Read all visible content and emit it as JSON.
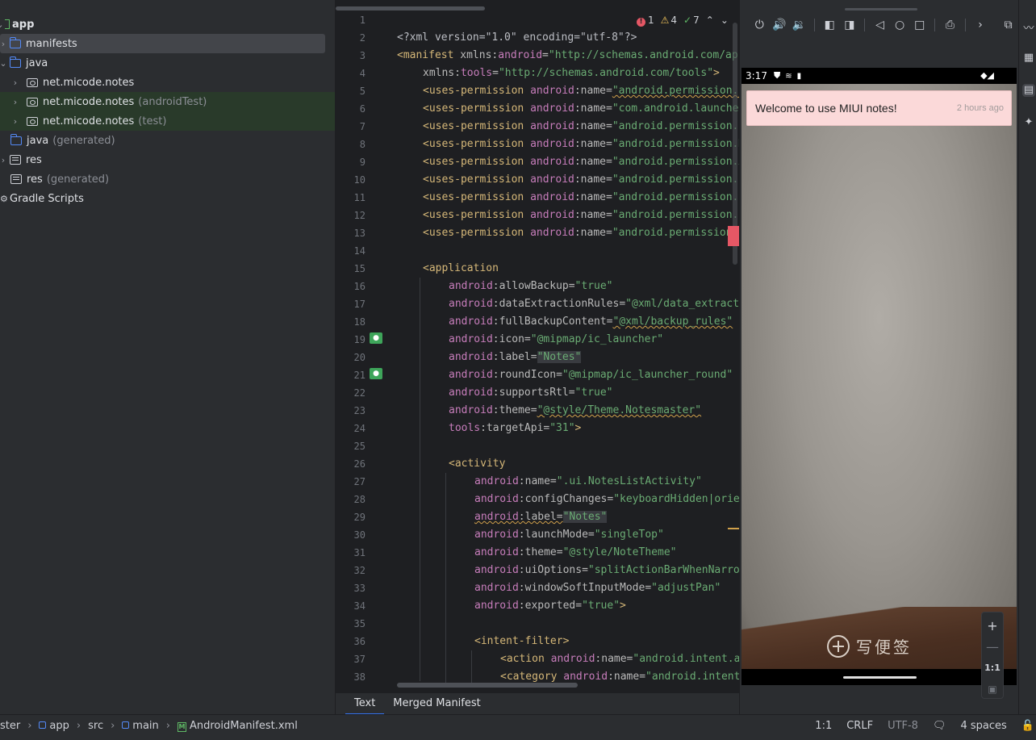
{
  "project_tree": {
    "items": [
      {
        "label": "app",
        "suffix": "",
        "icon": "module-icon"
      },
      {
        "label": "manifests",
        "suffix": "",
        "icon": "folder-icon"
      },
      {
        "label": "java",
        "suffix": "",
        "icon": "folder-icon"
      },
      {
        "label": "net.micode.notes",
        "suffix": "",
        "icon": "package-icon"
      },
      {
        "label": "net.micode.notes",
        "suffix": "(androidTest)",
        "icon": "package-icon"
      },
      {
        "label": "net.micode.notes",
        "suffix": "(test)",
        "icon": "package-icon"
      },
      {
        "label": "java",
        "suffix": "(generated)",
        "icon": "folder-icon"
      },
      {
        "label": "res",
        "suffix": "",
        "icon": "res-folder-icon"
      },
      {
        "label": "res",
        "suffix": "(generated)",
        "icon": "res-folder-icon"
      },
      {
        "label": "Gradle Scripts",
        "suffix": "",
        "icon": "gradle-icon"
      }
    ]
  },
  "editor": {
    "inspections": {
      "errors": "1",
      "warnings": "4",
      "typos": "7"
    },
    "line_numbers": [
      "1",
      "2",
      "3",
      "4",
      "5",
      "6",
      "7",
      "8",
      "9",
      "10",
      "11",
      "12",
      "13",
      "14",
      "15",
      "16",
      "17",
      "18",
      "19",
      "20",
      "21",
      "22",
      "23",
      "24",
      "25",
      "26",
      "27",
      "28",
      "29",
      "30",
      "31",
      "32",
      "33",
      "34",
      "35",
      "36",
      "37",
      "38"
    ],
    "lines": {
      "l1": "<?xml version=\"1.0\" encoding=\"utf-8\"?>",
      "l2a": "<manifest",
      "l2b": " xmlns:",
      "l2c": "android",
      "l2d": "=",
      "l2e": "\"http://schemas.android.com/apk/res/android\"",
      "l3a": "xmlns:",
      "l3b": "tools",
      "l3c": "=",
      "l3d": "\"http://schemas.android.com/tools\"",
      "l3e": ">",
      "perm_tag": "<uses-permission",
      "ns_android": "android",
      "attr_name": ":name=",
      "l5": "\"android.permission.INTERNET\"",
      "l6": "\"com.android.launcher.permission.INSTALL_SHORTCUT\"",
      "l7": "\"android.permission.READ_CONTACTS\"",
      "l8": "\"android.permission.MANAGE_ACCOUNTS\"",
      "l9": "\"android.permission.AUTHENTICATE_ACCOUNTS\"",
      "l10": "\"android.permission.GET_ACCOUNTS\"",
      "l11": "\"android.permission.USE_CREDENTIALS\"",
      "l12": "\"android.permission.RECEIVE_BOOT_COMPLETED\"",
      "l13": "\"android.permission.WRITE_EXTERNAL_STORAGE\"",
      "l15": "<application",
      "l16a": ":allowBackup=",
      "l16b": "\"true\"",
      "l17a": ":dataExtractionRules=",
      "l17b": "\"@xml/data_extraction_rules\"",
      "l18a": ":fullBackupContent=",
      "l18b": "\"@xml/backup_rules\"",
      "l19a": ":icon=",
      "l19b": "\"@mipmap/ic_launcher\"",
      "l20a": ":label=",
      "l20b": "\"Notes\"",
      "l21a": ":roundIcon=",
      "l21b": "\"@mipmap/ic_launcher_round\"",
      "l22a": ":supportsRtl=",
      "l22b": "\"true\"",
      "l23a": ":theme=",
      "l23b": "\"@style/Theme.Notesmaster\"",
      "l24ns": "tools",
      "l24a": ":targetApi=",
      "l24b": "\"31\"",
      "l24c": ">",
      "l26": "<activity",
      "l27a": ":name=",
      "l27b": "\".ui.NotesListActivity\"",
      "l28a": ":configChanges=",
      "l28b": "\"keyboardHidden|orientation\"",
      "l29a": ":label=",
      "l29b": "\"Notes\"",
      "l30a": ":launchMode=",
      "l30b": "\"singleTop\"",
      "l31a": ":theme=",
      "l31b": "\"@style/NoteTheme\"",
      "l32a": ":uiOptions=",
      "l32b": "\"splitActionBarWhenNarrow\"",
      "l33a": ":windowSoftInputMode=",
      "l33b": "\"adjustPan\"",
      "l34a": ":exported=",
      "l34b": "\"true\"",
      "l34c": ">",
      "l36": "<intent-filter>",
      "l37a": "<action",
      "l37b": ":name=",
      "l37c": "\"android.intent.action.MAIN\"",
      "l38a": "<category",
      "l38b": ":name=",
      "l38c": "\"android.intent.category.LAUNCHER\""
    }
  },
  "editor_tabs": {
    "text": "Text",
    "merged": "Merged Manifest"
  },
  "emulator": {
    "status_time": "3:17",
    "note_title": "Welcome to use MIUI notes!",
    "note_time": "2 hours ago",
    "new_note_label": "写便签",
    "zoom": {
      "in": "+",
      "out": "—",
      "one_to_one": "1:1"
    }
  },
  "status_bar": {
    "breadcrumbs": [
      "ster",
      "app",
      "src",
      "main",
      "AndroidManifest.xml"
    ],
    "position": "1:1",
    "line_sep": "CRLF",
    "encoding": "UTF-8",
    "indent": "4 spaces"
  },
  "colors": {
    "accent": "#3574f0",
    "error": "#e55765",
    "warning": "#d1a14b",
    "note_bg": "#fbd9d9"
  }
}
